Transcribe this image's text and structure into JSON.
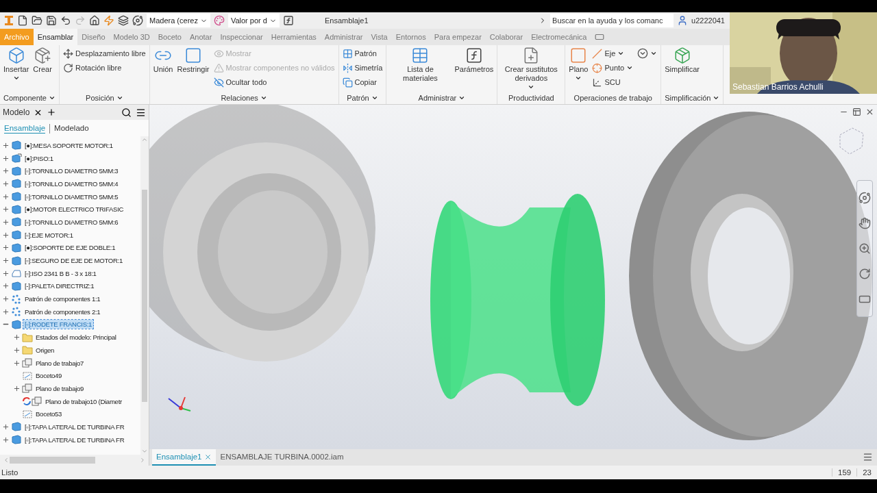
{
  "quick_access": {
    "material": "Madera (cerez",
    "appearance": "Valor por d"
  },
  "title": "Ensamblaje1",
  "search": {
    "placeholder": "Buscar en la ayuda y los comanc"
  },
  "user": "u2222041",
  "ribbon_tabs": [
    {
      "label": "Archivo",
      "kind": "file",
      "selected": false
    },
    {
      "label": "Ensamblar",
      "kind": "tab",
      "selected": true
    },
    {
      "label": "Diseño",
      "kind": "tab",
      "selected": false
    },
    {
      "label": "Modelo 3D",
      "kind": "tab",
      "selected": false
    },
    {
      "label": "Boceto",
      "kind": "tab",
      "selected": false
    },
    {
      "label": "Anotar",
      "kind": "tab",
      "selected": false
    },
    {
      "label": "Inspeccionar",
      "kind": "tab",
      "selected": false
    },
    {
      "label": "Herramientas",
      "kind": "tab",
      "selected": false
    },
    {
      "label": "Administrar",
      "kind": "tab",
      "selected": false
    },
    {
      "label": "Vista",
      "kind": "tab",
      "selected": false
    },
    {
      "label": "Entornos",
      "kind": "tab",
      "selected": false
    },
    {
      "label": "Para empezar",
      "kind": "tab",
      "selected": false
    },
    {
      "label": "Colaborar",
      "kind": "tab",
      "selected": false
    },
    {
      "label": "Electromecánica",
      "kind": "tab",
      "selected": false
    }
  ],
  "ribbon_groups": [
    {
      "label": "Componente",
      "menu": true,
      "buttons": [
        {
          "kind": "large",
          "label": "Insertar",
          "menu": true,
          "disabled": false
        },
        {
          "kind": "large",
          "label": "Crear",
          "menu": false,
          "disabled": false
        }
      ]
    },
    {
      "label": "Posición",
      "menu": true,
      "buttons": [
        {
          "kind": "small",
          "label": "Desplazamiento libre",
          "menu": false,
          "disabled": false
        },
        {
          "kind": "small",
          "label": "Rotación libre",
          "menu": false,
          "disabled": false
        }
      ]
    },
    {
      "label": "Relaciones",
      "menu": true,
      "buttons": [
        {
          "kind": "large",
          "label": "Unión",
          "menu": false,
          "disabled": false
        },
        {
          "kind": "large",
          "label": "Restringir",
          "menu": false,
          "disabled": false
        },
        {
          "kind": "small",
          "label": "Mostrar",
          "menu": false,
          "disabled": true
        },
        {
          "kind": "small",
          "label": "Mostrar componentes no válidos",
          "menu": false,
          "disabled": true
        },
        {
          "kind": "small",
          "label": "Ocultar todo",
          "menu": false,
          "disabled": false
        }
      ]
    },
    {
      "label": "Patrón",
      "menu": true,
      "buttons": [
        {
          "kind": "small",
          "label": "Patrón",
          "menu": false,
          "disabled": false
        },
        {
          "kind": "small",
          "label": "Simetría",
          "menu": false,
          "disabled": false
        },
        {
          "kind": "small",
          "label": "Copiar",
          "menu": false,
          "disabled": false
        }
      ]
    },
    {
      "label": "Administrar",
      "menu": true,
      "buttons": [
        {
          "kind": "large",
          "label": "Lista de materiales",
          "menu": false,
          "disabled": false
        },
        {
          "kind": "large",
          "label": "Parámetros",
          "menu": false,
          "disabled": false
        }
      ]
    },
    {
      "label": "Productividad",
      "menu": false,
      "buttons": [
        {
          "kind": "large",
          "label": "Crear sustitutos derivados",
          "menu": true,
          "disabled": false
        }
      ]
    },
    {
      "label": "Operaciones de trabajo",
      "menu": false,
      "buttons": [
        {
          "kind": "large",
          "label": "Plano",
          "menu": true,
          "disabled": false
        },
        {
          "kind": "small",
          "label": "Eje",
          "menu": true,
          "disabled": false
        },
        {
          "kind": "small",
          "label": "Punto",
          "menu": true,
          "disabled": false
        },
        {
          "kind": "small",
          "label": "SCU",
          "menu": false,
          "disabled": false
        },
        {
          "kind": "icon",
          "menu": true,
          "disabled": false
        }
      ]
    },
    {
      "label": "Simplificación",
      "menu": true,
      "buttons": [
        {
          "kind": "large",
          "label": "Simplificar",
          "menu": false,
          "disabled": false
        }
      ]
    }
  ],
  "browser": {
    "tab": "Modelo",
    "views": [
      {
        "label": "Ensamblaje",
        "selected": true
      },
      {
        "label": "Modelado",
        "selected": false
      }
    ],
    "tree": [
      {
        "label": "[●]:MESA SOPORTE MOTOR:1",
        "kind": "part",
        "expandable": true,
        "expanded": false,
        "selected": false
      },
      {
        "label": "[●]:PISO:1",
        "kind": "part-link",
        "expandable": true,
        "expanded": false,
        "selected": false
      },
      {
        "label": "[▫]:TORNILLO DIAMETRO 5MM:3",
        "kind": "part",
        "expandable": true,
        "expanded": false,
        "selected": false
      },
      {
        "label": "[▫]:TORNILLO DIAMETRO 5MM:4",
        "kind": "part",
        "expandable": true,
        "expanded": false,
        "selected": false
      },
      {
        "label": "[▫]:TORNILLO DIAMETRO 5MM:5",
        "kind": "part",
        "expandable": true,
        "expanded": false,
        "selected": false
      },
      {
        "label": "[●]:MOTOR ELECTRICO TRIFASIC",
        "kind": "part",
        "expandable": true,
        "expanded": false,
        "selected": false
      },
      {
        "label": "[▫]:TORNILLO DIAMETRO 5MM:6",
        "kind": "part",
        "expandable": true,
        "expanded": false,
        "selected": false
      },
      {
        "label": "[▫]:EJE MOTOR:1",
        "kind": "part",
        "expandable": true,
        "expanded": false,
        "selected": false
      },
      {
        "label": "[●]:SOPORTE DE EJE DOBLE:1",
        "kind": "part",
        "expandable": true,
        "expanded": false,
        "selected": false
      },
      {
        "label": "[▫]:SEGURO DE EJE DE MOTOR:1",
        "kind": "part",
        "expandable": true,
        "expanded": false,
        "selected": false
      },
      {
        "label": "[▫]:ISO 2341 B B - 3 x 18:1",
        "kind": "fastener",
        "expandable": true,
        "expanded": false,
        "selected": false
      },
      {
        "label": "[-]:PALETA DIRECTRIZ:1",
        "kind": "part",
        "expandable": true,
        "expanded": false,
        "selected": false
      },
      {
        "label": "Patrón de componentes 1:1",
        "kind": "pattern",
        "expandable": true,
        "expanded": false,
        "selected": false
      },
      {
        "label": "Patrón de componentes 2:1",
        "kind": "pattern",
        "expandable": true,
        "expanded": false,
        "selected": false
      },
      {
        "label": "[▫]:RODETE FRANCIS:1",
        "kind": "part",
        "expandable": true,
        "expanded": true,
        "selected": true,
        "children": [
          {
            "label": "Estados del modelo: Principal",
            "kind": "folder",
            "expandable": true,
            "expanded": false,
            "selected": false
          },
          {
            "label": "Origen",
            "kind": "folder",
            "expandable": true,
            "expanded": false,
            "selected": false
          },
          {
            "label": "Plano de trabajo7",
            "kind": "plane",
            "expandable": true,
            "expanded": false,
            "selected": false
          },
          {
            "label": "Boceto49",
            "kind": "sketch",
            "expandable": false,
            "selected": false
          },
          {
            "label": "Plano de trabajo9",
            "kind": "plane",
            "expandable": true,
            "expanded": false,
            "selected": false
          },
          {
            "label": "Plano de trabajo10 (Diametr",
            "kind": "plane-update",
            "expandable": false,
            "selected": false
          },
          {
            "label": "Boceto53",
            "kind": "sketch",
            "expandable": false,
            "selected": false
          }
        ]
      },
      {
        "label": "[▫]:TAPA LATERAL DE TURBINA FR",
        "kind": "part",
        "expandable": true,
        "expanded": false,
        "selected": false
      },
      {
        "label": "[▫]:TAPA LATERAL DE TURBINA FR",
        "kind": "part",
        "expandable": true,
        "expanded": false,
        "selected": false
      }
    ]
  },
  "documents": [
    {
      "label": "Ensamblaje1",
      "selected": true
    },
    {
      "label": "ENSAMBLAJE TURBINA.0002.iam",
      "selected": false
    }
  ],
  "status": {
    "message": "Listo",
    "counts": [
      "159",
      "23"
    ]
  },
  "webcam": {
    "name": "Sebastian Barrios Achulli"
  }
}
